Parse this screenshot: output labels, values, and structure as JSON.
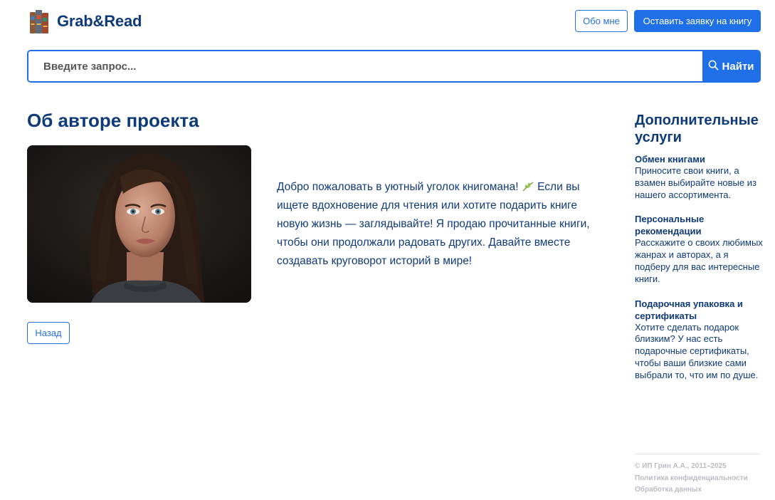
{
  "header": {
    "logo_text": "Grab&Read",
    "about_label": "Обо мне",
    "request_label": "Оставить заявку на книгу"
  },
  "search": {
    "placeholder": "Введите запрос...",
    "button_label": "Найти"
  },
  "main": {
    "title": "Об авторе проекта",
    "bio_part1": "Добро пожаловать в уютный уголок книгомана!",
    "bio_part2": "Если вы ищете вдохновение для чтения или хотите подарить книге новую жизнь — заглядывайте! Я продаю прочитанные книги, чтобы они продолжали радовать других. Давайте вместе создавать круговорот историй в мире!",
    "back_label": "Назад"
  },
  "sidebar": {
    "title": "Дополнительные услуги",
    "services": [
      {
        "name": "Обмен книгами",
        "text": "Приносите свои книги, а взамен выбирайте новые из нашего ассортимента."
      },
      {
        "name": "Персональные рекомендации",
        "text": "Расскажите о своих любимых жанрах и авторах, а я подберу для вас интересные книги."
      },
      {
        "name": "Подарочная упаковка и сертификаты",
        "text": "Хотите сделать подарок близким? У нас есть подарочные сертификаты, чтобы ваши близкие сами выбрали то, что им по душе."
      }
    ]
  },
  "footer": {
    "copyright": "© ИП Грин А.А., 2011–2025",
    "privacy": "Политика конфиденциальности",
    "data_processing": "Обработка данных"
  },
  "colors": {
    "primary": "#1f6fe8",
    "text": "#0f3a7a",
    "muted": "#b9bcc2"
  }
}
